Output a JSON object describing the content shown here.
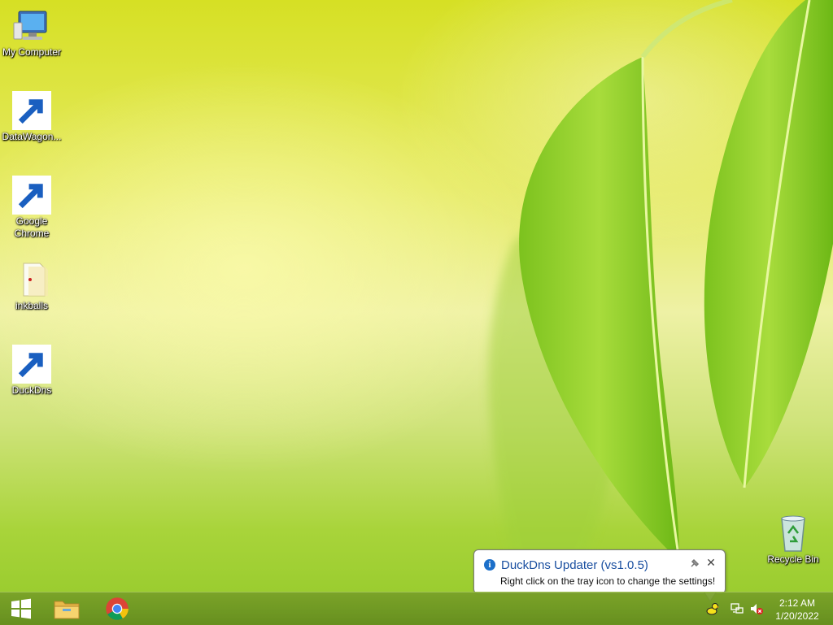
{
  "desktop": {
    "icons": [
      {
        "label": "My Computer"
      },
      {
        "label": "DataWagon..."
      },
      {
        "label": "Google Chrome"
      },
      {
        "label": "inkballs"
      },
      {
        "label": "DuckDns"
      },
      {
        "label": "Recycle Bin"
      }
    ]
  },
  "notification": {
    "title": "DuckDns Updater (vs1.0.5)",
    "message": "Right click on the tray icon to change the settings!",
    "info_icon": "i",
    "close_glyph": "✕"
  },
  "taskbar": {
    "start_icon": "windows-logo",
    "pinned": [
      "file-explorer",
      "google-chrome"
    ],
    "tray": [
      "duckdns-tray",
      "network",
      "volume-muted"
    ]
  },
  "clock": {
    "time": "2:12 AM",
    "date": "1/20/2022"
  }
}
